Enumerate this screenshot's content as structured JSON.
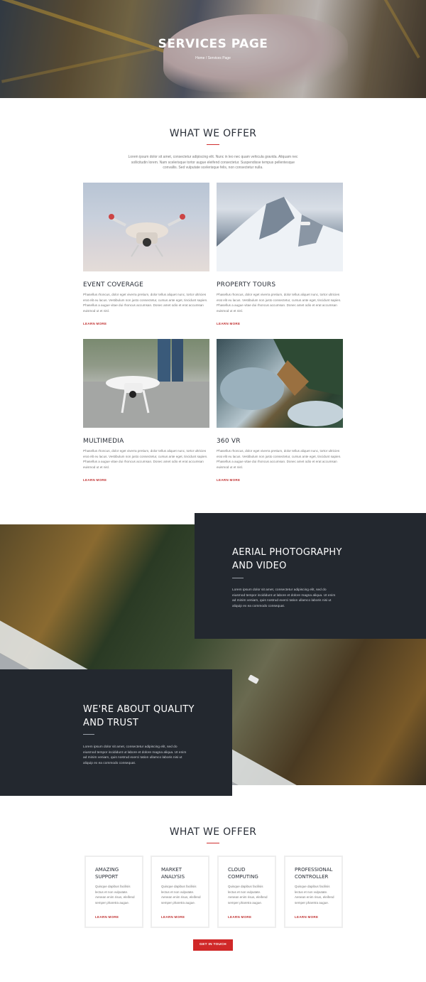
{
  "hero": {
    "title": "SERVICES PAGE",
    "breadcrumb": "Home / Services Page"
  },
  "offer": {
    "title": "WHAT WE OFFER",
    "intro": "Lorem ipsum dolor sit amet, consectetur adipiscing elit. Nunc in leo nec quam vehicula gravida. Aliquam nec sollicitudin lorem. Nam scelerisque tortor augue eleifend consectetur. Suspendisse tempus pellentesque convallis. Sed vulputate scelerisque felis, non consectetur nulla.",
    "services": [
      {
        "title": "EVENT COVERAGE",
        "text": "Phasellus rhoncus, dolor eget viverra pretium, dolor tellus aliquet nunc, tortor ultricies erat elit eu lacus. Vestibulum non justo consectetur, cursus ante eget, tincidunt sapien. Phasellus a augue vitae dui rhoncus accumsan. Donec amet odio et erat accumsan euismod ut et nisl.",
        "link": "LEARN MORE",
        "image": "drone-in-sky-photo"
      },
      {
        "title": "PROPERTY TOURS",
        "text": "Phasellus rhoncus, dolor eget viverra pretium, dolor tellus aliquet nunc, tortor ultricies erat elit eu lacus. Vestibulum non justo consectetur, cursus ante eget, tincidunt sapien. Phasellus a augue vitae dui rhoncus accumsan. Donec amet odio et erat accumsan euismod ut et nisl.",
        "link": "LEARN MORE",
        "image": "snowy-mountain-photo"
      },
      {
        "title": "MULTIMEDIA",
        "text": "Phasellus rhoncus, dolor eget viverra pretium, dolor tellus aliquet nunc, tortor ultricies erat elit eu lacus. Vestibulum non justo consectetur, cursus ante eget, tincidunt sapien. Phasellus a augue vitae dui rhoncus accumsan. Donec amet odio et erat accumsan euismod ut et nisl.",
        "link": "LEARN MORE",
        "image": "drone-on-road-photo"
      },
      {
        "title": "360 VR",
        "text": "Phasellus rhoncus, dolor eget viverra pretium, dolor tellus aliquet nunc, tortor ultricies erat elit eu lacus. Vestibulum non justo consectetur, cursus ante eget, tincidunt sapien. Phasellus a augue vitae dui rhoncus accumsan. Donec amet odio et erat accumsan euismod ut et nisl.",
        "link": "LEARN MORE",
        "image": "aerial-frozen-lake-photo"
      }
    ]
  },
  "aerial": {
    "title_line1": "AERIAL PHOTOGRAPHY",
    "title_line2": "AND VIDEO",
    "text": "Lorem ipsum dolor sit amet, consectetur adipiscing elit, sed do eiusmod tempor incididunt ut labore et dolore magna aliqua. Ut enim ad minim veniam, quis nostrud exerci tation ullamco laboris nisi ut aliquip ex ea commodo consequat."
  },
  "quality": {
    "title_line1": "WE'RE ABOUT QUALITY",
    "title_line2": "AND TRUST",
    "text": "Lorem ipsum dolor sit amet, consectetur adipiscing elit, sed do eiusmod tempor incididunt ut labore et dolore magna aliqua. Ut enim ad minim veniam, quis nostrud exerci tation ullamco laboris nisi ut aliquip ex ea commodo consequat."
  },
  "offer2": {
    "title": "WHAT WE OFFER",
    "features": [
      {
        "title": "AMAZING SUPPORT",
        "text": "Quisque dapibus facilisis lectus et non vulputate. Aenean enim risus, eleifend semper pharetra augue.",
        "link": "LEARN MORE"
      },
      {
        "title": "MARKET ANALYSIS",
        "text": "Quisque dapibus facilisis lectus et non vulputate. Aenean enim risus, eleifend semper pharetra augue.",
        "link": "LEARN MORE"
      },
      {
        "title": "CLOUD COMPUTING",
        "text": "Quisque dapibus facilisis lectus et non vulputate. Aenean enim risus, eleifend semper pharetra augue.",
        "link": "LEARN MORE"
      },
      {
        "title": "PROFESSIONAL CONTROLLER",
        "text": "Quisque dapibus facilisis lectus et non vulputate. Aenean enim risus, eleifend semper pharetra augue.",
        "link": "LEARN MORE"
      }
    ],
    "cta": "GET IN TOUCH"
  },
  "colors": {
    "accent": "#d02828",
    "dark_panel": "#23282f",
    "heading": "#2a2f38"
  }
}
